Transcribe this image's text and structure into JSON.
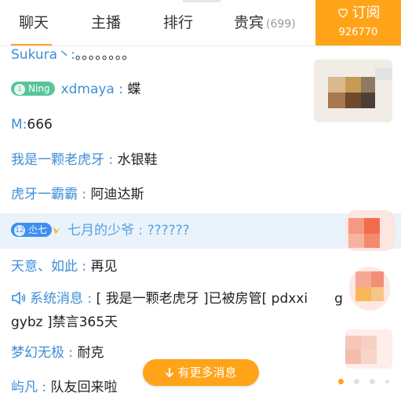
{
  "tabs": [
    {
      "label": "聊天"
    },
    {
      "label": "主播"
    },
    {
      "label": "排行"
    },
    {
      "label": "贵宾",
      "count": "(699)"
    }
  ],
  "subscribe": {
    "label": "订阅",
    "count": "926770",
    "icon": "heart-icon"
  },
  "messages": [
    {
      "nick": "Sukura丶",
      "sep": ":",
      "text": "。。。。。。。。"
    },
    {
      "badge_level": "1",
      "badge_label": "Ning",
      "nick": "xdmaya",
      "sep": ":",
      "text": "蝶"
    },
    {
      "nick": "M",
      "sep": ":",
      "text": "666"
    },
    {
      "nick": "我是一颗老虎牙",
      "sep": ":",
      "text": "水银鞋"
    },
    {
      "nick": "虎牙一霸霸",
      "sep": ":",
      "text": "阿迪达斯"
    },
    {
      "badge_level": "12",
      "badge_label": "尐七",
      "nick": "七月的少爷",
      "sep": ":",
      "text": "??????"
    },
    {
      "nick": "天意、如此",
      "sep": ":",
      "text": "再见"
    },
    {
      "nick": "梦幻无极",
      "sep": ":",
      "text": "耐克"
    },
    {
      "nick": "屿凡",
      "sep": ":",
      "text": "队友回来啦"
    }
  ],
  "system_message": {
    "label": "系统消息",
    "sep": ":",
    "line1": "[ 我是一颗老虎牙 ]已被房管[ pdxxi",
    "line1_tail": "g",
    "line2": "gybz ]禁言365天"
  },
  "more_button": {
    "label": "有更多消息",
    "icon": "arrow-down-icon"
  },
  "colors": {
    "accent": "#ffa319",
    "nick": "#3e8ed8",
    "highlight": "#eaf3fc"
  }
}
